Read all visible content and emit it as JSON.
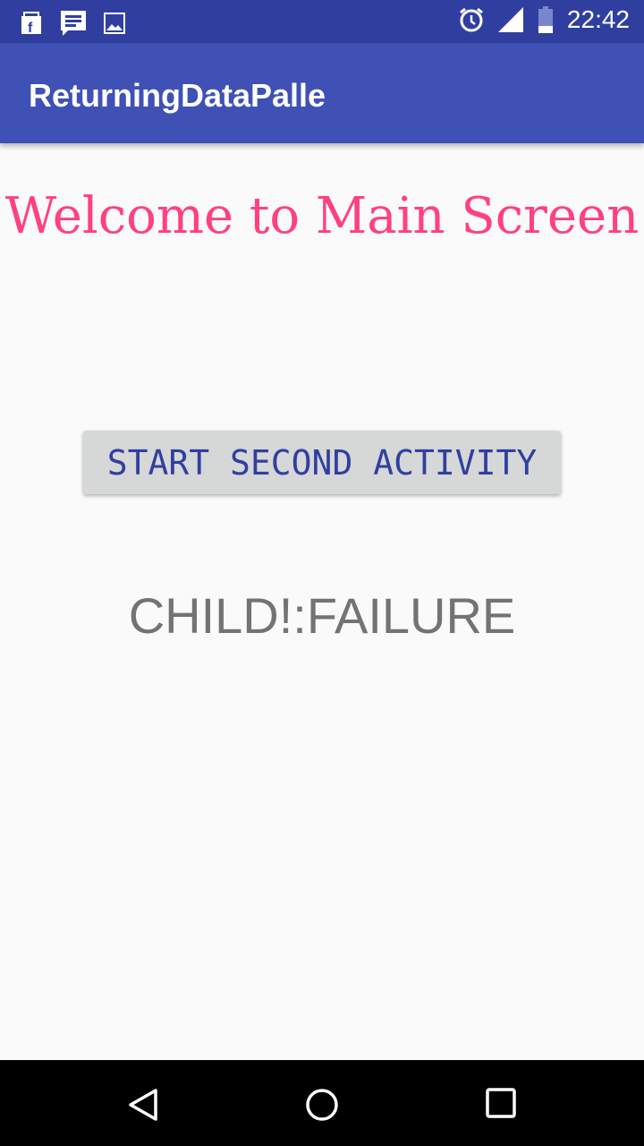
{
  "status_bar": {
    "time": "22:42",
    "icons_left": [
      "shopping-bag-icon",
      "message-icon",
      "image-icon"
    ],
    "icons_right": [
      "alarm-icon",
      "signal-icon",
      "battery-icon"
    ]
  },
  "app_bar": {
    "title": "ReturningDataPalle"
  },
  "main": {
    "welcome_text": "Welcome to Main Screen",
    "start_button_label": "START SECOND ACTIVITY",
    "result_text": "CHILD!:FAILURE"
  },
  "nav_bar": {
    "icons": [
      "back-icon",
      "home-icon",
      "recents-icon"
    ]
  },
  "colors": {
    "primary": "#3f51b5",
    "primary_dark": "#303f9f",
    "accent": "#ff4081"
  }
}
